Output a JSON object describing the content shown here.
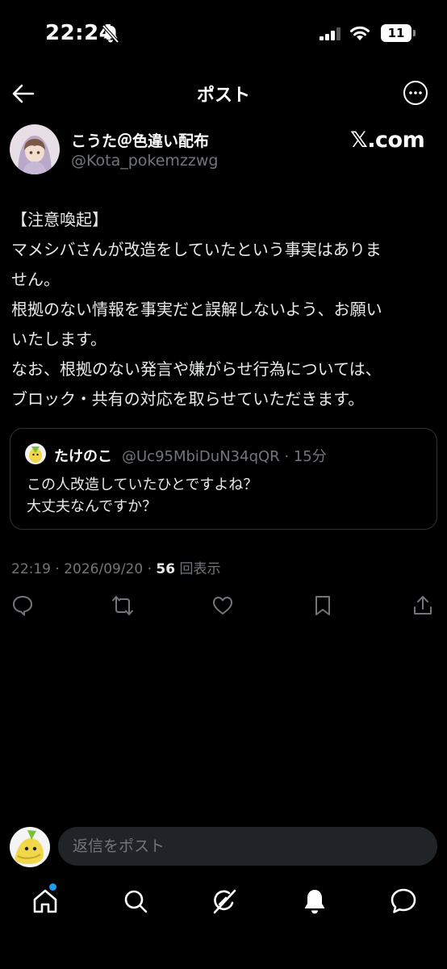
{
  "status_bar": {
    "time": "22:24",
    "battery": "11"
  },
  "header": {
    "title": "ポスト"
  },
  "post": {
    "display_name": "こうた＠色違い配布",
    "handle": "@Kota_pokemzzwg",
    "source_label": "𝕏.com",
    "lines": [
      "【注意喚起】",
      "マメシバさんが改造をしていたという事実はありま",
      "せん。",
      "根拠のない情報を事実だと誤解しないよう、お願い",
      "いたします。",
      "なお、根拠のない発言や嫌がらせ行為については、",
      "ブロック・共有の対応を取らせていただきます。"
    ],
    "quote": {
      "name": "たけのこ",
      "handle_time": "@Uc95MbiDuN34qQR · 15分",
      "lines": [
        "この人改造していたひとですよね？",
        "大丈夫なんですか？"
      ]
    },
    "meta": {
      "timestamp": "22:19 · 2026/09/20 · ",
      "views": "56",
      "views_label": " 回表示"
    }
  },
  "reply": {
    "placeholder": "返信をポスト"
  },
  "icons": {
    "back": "arrow-left-icon",
    "more": "more-horizontal-icon",
    "reply": "chat-bubble-icon",
    "repost": "repost-icon",
    "like": "heart-icon",
    "bookmark": "bookmark-icon",
    "share": "share-icon",
    "home": "home-icon",
    "search": "search-icon",
    "grok": "grok-icon",
    "notifications": "bell-icon",
    "messages": "message-bubble-icon"
  },
  "colors": {
    "background": "#000000",
    "text": "#e7e9ea",
    "muted": "#71767b",
    "accent": "#1d9bf0",
    "border": "#2f3336"
  }
}
